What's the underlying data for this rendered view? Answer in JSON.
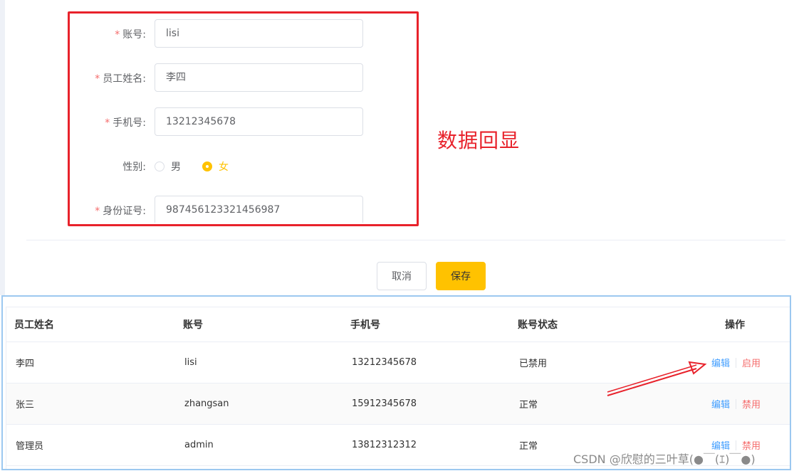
{
  "form": {
    "account": {
      "label": "账号:",
      "value": "lisi"
    },
    "name": {
      "label": "员工姓名:",
      "value": "李四"
    },
    "phone": {
      "label": "手机号:",
      "value": "13212345678"
    },
    "gender": {
      "label": "性别:",
      "options": [
        "男",
        "女"
      ],
      "selected": "女"
    },
    "idcard": {
      "label": "身份证号:",
      "value": "987456123321456987"
    },
    "required_mark": "*"
  },
  "annotation": {
    "echo_text": "数据回显",
    "box_color": "#e8222b"
  },
  "buttons": {
    "cancel": "取消",
    "save": "保存"
  },
  "table": {
    "headers": [
      "员工姓名",
      "账号",
      "手机号",
      "账号状态",
      "操作"
    ],
    "rows": [
      {
        "name": "李四",
        "account": "lisi",
        "phone": "13212345678",
        "status": "已禁用",
        "edit": "编辑",
        "action": "启用"
      },
      {
        "name": "张三",
        "account": "zhangsan",
        "phone": "15912345678",
        "status": "正常",
        "edit": "编辑",
        "action": "禁用"
      },
      {
        "name": "管理员",
        "account": "admin",
        "phone": "13812312312",
        "status": "正常",
        "edit": "编辑",
        "action": "禁用"
      }
    ]
  },
  "watermark": "CSDN @欣慰的三叶草(●￣(ｴ)￣●)",
  "colors": {
    "accent": "#ffc200",
    "link": "#419eff",
    "danger": "#f56c6c"
  }
}
